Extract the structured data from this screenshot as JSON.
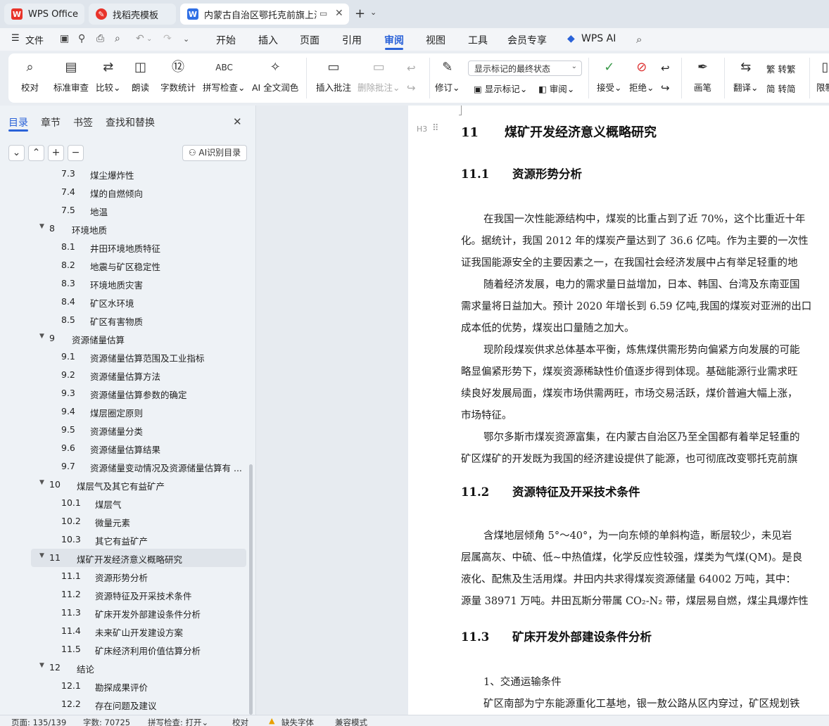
{
  "titlebar": {
    "tabs": [
      {
        "label": "WPS Office",
        "icon": "wps-logo-icon"
      },
      {
        "label": "找稻壳模板",
        "icon": "docer-icon"
      },
      {
        "label": "内蒙古自治区鄂托克前旗上海",
        "icon": "word-doc-icon",
        "active": true
      }
    ],
    "new_tab": "+",
    "tab_list": "⌄"
  },
  "menubar": {
    "file": "文件",
    "items": [
      "开始",
      "插入",
      "页面",
      "引用",
      "审阅",
      "视图",
      "工具",
      "会员专享"
    ],
    "active": "审阅",
    "wps_ai": "WPS AI"
  },
  "ribbon": {
    "proofread": "校对",
    "standard_review": "标准审查",
    "compare": "比较",
    "read_aloud": "朗读",
    "word_count": "字数统计",
    "spell_check": "拼写检查",
    "ai_polish": "AI 全文润色",
    "insert_comment": "插入批注",
    "delete_comment": "删除批注",
    "track_changes": "修订",
    "markup_mode": "显示标记的最终状态",
    "show_markup": "显示标记",
    "review": "审阅",
    "accept": "接受",
    "reject": "拒绝",
    "ink": "画笔",
    "translate": "翻译",
    "to_traditional": "转繁",
    "to_simplified": "转简",
    "restrict": "限制"
  },
  "navpane": {
    "tabs": [
      "目录",
      "章节",
      "书签",
      "查找和替换"
    ],
    "active_tab": "目录",
    "ai_toc": "AI识别目录",
    "toc": [
      {
        "num": "7.3",
        "title": "煤尘爆炸性",
        "level": 2
      },
      {
        "num": "7.4",
        "title": "煤的自燃倾向",
        "level": 2
      },
      {
        "num": "7.5",
        "title": "地温",
        "level": 2
      },
      {
        "num": "8",
        "title": "环境地质",
        "level": 1
      },
      {
        "num": "8.1",
        "title": "井田环境地质特征",
        "level": 2
      },
      {
        "num": "8.2",
        "title": "地震与矿区稳定性",
        "level": 2
      },
      {
        "num": "8.3",
        "title": "环境地质灾害",
        "level": 2
      },
      {
        "num": "8.4",
        "title": "矿区水环境",
        "level": 2
      },
      {
        "num": "8.5",
        "title": "矿区有害物质",
        "level": 2
      },
      {
        "num": "9",
        "title": "资源储量估算",
        "level": 1
      },
      {
        "num": "9.1",
        "title": "资源储量估算范围及工业指标",
        "level": 2
      },
      {
        "num": "9.2",
        "title": "资源储量估算方法",
        "level": 2
      },
      {
        "num": "9.3",
        "title": "资源储量估算参数的确定",
        "level": 2
      },
      {
        "num": "9.4",
        "title": "煤层圈定原则",
        "level": 2
      },
      {
        "num": "9.5",
        "title": "资源储量分类",
        "level": 2
      },
      {
        "num": "9.6",
        "title": "资源储量估算结果",
        "level": 2
      },
      {
        "num": "9.7",
        "title": "资源储量变动情况及资源储量估算有 ...",
        "level": 2
      },
      {
        "num": "10",
        "title": "煤层气及其它有益矿产",
        "level": 1
      },
      {
        "num": "10.1",
        "title": "煤层气",
        "level": 2
      },
      {
        "num": "10.2",
        "title": "微量元素",
        "level": 2
      },
      {
        "num": "10.3",
        "title": "其它有益矿产",
        "level": 2
      },
      {
        "num": "11",
        "title": "煤矿开发经济意义概略研究",
        "level": 1,
        "selected": true
      },
      {
        "num": "11.1",
        "title": "资源形势分析",
        "level": 2
      },
      {
        "num": "11.2",
        "title": "资源特征及开采技术条件",
        "level": 2
      },
      {
        "num": "11.3",
        "title": "矿床开发外部建设条件分析",
        "level": 2
      },
      {
        "num": "11.4",
        "title": "未来矿山开发建设方案",
        "level": 2
      },
      {
        "num": "11.5",
        "title": "矿床经济利用价值估算分析",
        "level": 2
      },
      {
        "num": "12",
        "title": "结论",
        "level": 1
      },
      {
        "num": "12.1",
        "title": "勘探成果评价",
        "level": 2
      },
      {
        "num": "12.2",
        "title": "存在问题及建议",
        "level": 2
      }
    ]
  },
  "document": {
    "heading_marker": "H3",
    "h1": {
      "num": "11",
      "title": "煤矿开发经济意义概略研究"
    },
    "sections": [
      {
        "num": "11.1",
        "title": "资源形势分析",
        "lines": [
          "在我国一次性能源结构中，煤炭的比重占到了近 70%，这个比重近十年",
          "化。据统计，我国 2012 年的煤炭产量达到了 36.6 亿吨。作为主要的一次性",
          "证我国能源安全的主要因素之一，在我国社会经济发展中占有举足轻重的地",
          "随着经济发展，电力的需求量日益增加，日本、韩国、台湾及东南亚国",
          "需求量将日益加大。预计 2020 年增长到 6.59 亿吨,我国的煤炭对亚洲的出口",
          "成本低的优势，煤炭出口量随之加大。",
          "现阶段煤炭供求总体基本平衡，炼焦煤供需形势向偏紧方向发展的可能",
          "略显偏紧形势下，煤炭资源稀缺性价值逐步得到体现。基础能源行业需求旺",
          "续良好发展局面，煤炭市场供需两旺，市场交易活跃，煤价普遍大幅上涨，",
          "市场特征。",
          "鄂尔多斯市煤炭资源富集，在内蒙古自治区乃至全国都有着举足轻重的",
          "矿区煤矿的开发既为我国的经济建设提供了能源，也可彻底改变鄂托克前旗"
        ]
      },
      {
        "num": "11.2",
        "title": "资源特征及开采技术条件",
        "lines": [
          "含煤地层倾角 5°～40°，为一向东倾的单斜构造，断层较少，未见岩",
          "层属高灰、中硫、低~中热值煤，化学反应性较强，煤类为气煤(QM)。是良",
          "液化、配焦及生活用煤。井田内共求得煤炭资源储量 64002 万吨，其中：",
          "源量 38971 万吨。井田瓦斯分带属 CO₂-N₂ 带，煤层易自燃，煤尘具爆炸性"
        ]
      },
      {
        "num": "11.3",
        "title": "矿床开发外部建设条件分析",
        "lines": [
          "1、交通运输条件",
          "矿区南部为宁东能源重化工基地，银一敖公路从区内穿过，矿区规划铁"
        ]
      }
    ]
  },
  "statusbar": {
    "page": "页面: 135/139",
    "words": "字数: 70725",
    "spell": "拼写检查: 打开",
    "spell_arrow": "⌄",
    "proof": "校对",
    "missing_font": "缺失字体",
    "compat": "兼容模式"
  },
  "colors": {
    "accent": "#2a62d8",
    "wps_red": "#e8332a",
    "doc_blue": "#2f6fe5",
    "warning": "#e8a000"
  }
}
